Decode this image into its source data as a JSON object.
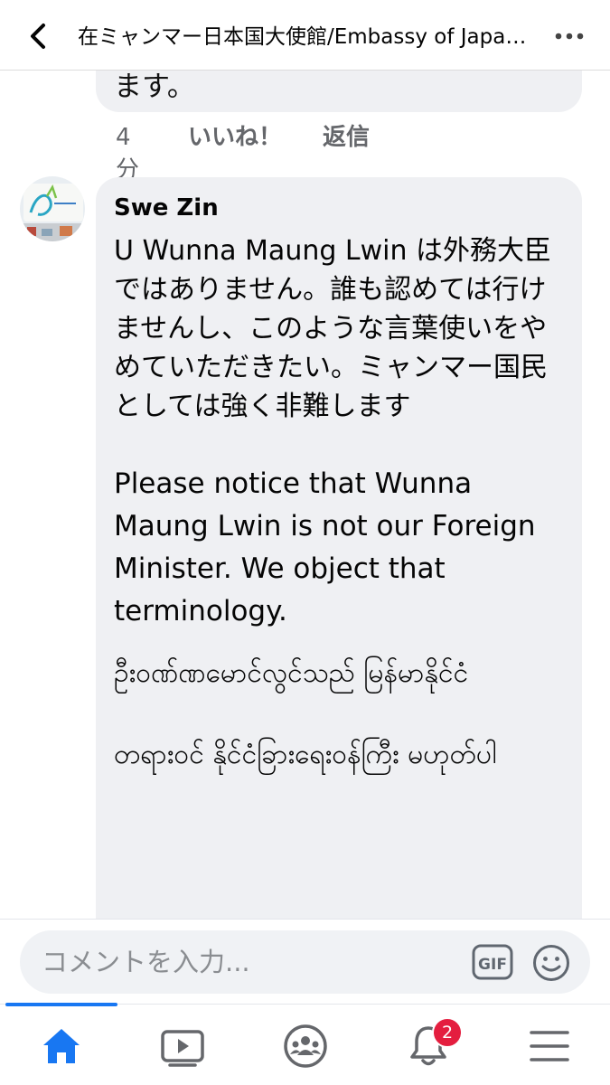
{
  "header": {
    "title": "在ミャンマー日本国大使館/Embassy of Japan in Myanmar",
    "back_icon": "chevron-left-icon",
    "more_icon": "ellipsis-icon"
  },
  "previous_comment": {
    "text_tail": "ます。",
    "time": "4分",
    "like_label": "いいね！",
    "reply_label": "返信"
  },
  "comment": {
    "author": "Swe Zin",
    "text_ja": "U Wunna Maung Lwin は外務大臣ではありません。誰も認めては行けませんし、このような言葉使いをやめていただきたい。ミャンマー国民としては強く非難します",
    "text_en": "Please notice that Wunna Maung Lwin is not our Foreign Minister. We object that terminology.",
    "text_my": "ဦးဝဏ်ဏမောင်လွင်သည် မြန်မာနိုင်ငံ တရား၀င် နိုင်ငံခြားရေးဝန်ကြီး မဟုတ်ပါ"
  },
  "composer": {
    "placeholder": "コメントを入力...",
    "gif_label": "GIF",
    "emoji_icon": "smiley-icon"
  },
  "nav": {
    "items": [
      "home-icon",
      "video-icon",
      "groups-icon",
      "notifications-icon",
      "menu-icon"
    ],
    "notification_count": "2",
    "active": "home"
  },
  "colors": {
    "accent": "#1877f2",
    "bubble": "#eff0f3",
    "badge": "#e41e3f",
    "muted_text": "#65676b"
  }
}
